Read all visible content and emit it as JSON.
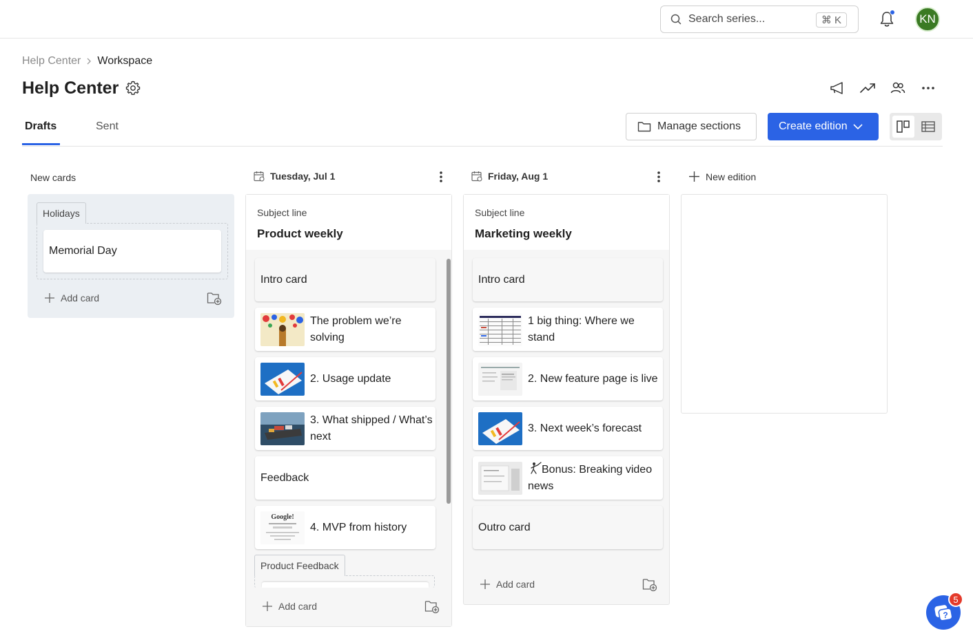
{
  "topbar": {
    "search_placeholder": "Search series...",
    "search_shortcut": "⌘ K",
    "notifications_dot": true,
    "avatar_initials": "KN",
    "avatar_color": "#3a7a23"
  },
  "breadcrumb": [
    "Help Center",
    "Workspace"
  ],
  "page_title": "Help Center",
  "tabs": [
    {
      "label": "Drafts",
      "active": true
    },
    {
      "label": "Sent",
      "active": false
    }
  ],
  "actions": {
    "manage_sections": "Manage sections",
    "create_edition": "Create edition"
  },
  "accent_color": "#2b63e5",
  "new_cards": {
    "heading": "New cards",
    "section": "Holidays",
    "cards": [
      "Memorial Day"
    ],
    "add_card": "Add card"
  },
  "editions": [
    {
      "date": "Tuesday, Jul 1",
      "subject_label": "Subject line",
      "subject": "Product weekly",
      "cards": [
        {
          "title": "Intro card",
          "thumb": null
        },
        {
          "title": "The problem we’re solving",
          "thumb": "collage-image"
        },
        {
          "title": "2. Usage update",
          "thumb": "chart-image"
        },
        {
          "title": "3. What shipped / What’s next",
          "thumb": "ship-image"
        },
        {
          "title": "Feedback",
          "thumb": null
        },
        {
          "title": "4. MVP from history",
          "thumb": "google-page-image"
        }
      ],
      "section": "Product Feedback",
      "add_card": "Add card"
    },
    {
      "date": "Friday, Aug 1",
      "subject_label": "Subject line",
      "subject": "Marketing weekly",
      "cards": [
        {
          "title": "Intro card",
          "thumb": null
        },
        {
          "title": "1 big thing: Where we stand",
          "thumb": "table-image"
        },
        {
          "title": "2. New feature page is live",
          "thumb": "document-image"
        },
        {
          "title": "3. Next week’s forecast",
          "thumb": "chart-image"
        },
        {
          "title": "Bonus: Breaking video news",
          "thumb": "screenshot-image",
          "prefix_icon": "fencer-emoji"
        },
        {
          "title": "Outro card",
          "thumb": null
        }
      ],
      "add_card": "Add card"
    }
  ],
  "new_edition": "New edition",
  "help_badge": "5"
}
